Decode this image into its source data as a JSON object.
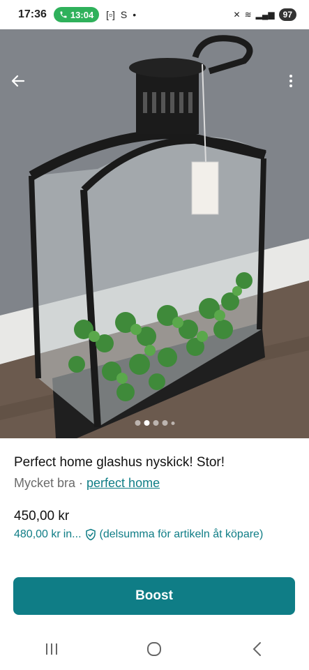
{
  "status_bar": {
    "time": "17:36",
    "call_timer": "13:04",
    "battery": "97",
    "icons": [
      "phone-icon",
      "screen-record-icon",
      "s-icon",
      "dot-icon",
      "mute-icon",
      "wifi-icon",
      "signal-icon",
      "battery-icon"
    ]
  },
  "hero": {
    "image_subject": "glass-lantern-terrarium-photo",
    "dots_total": 5,
    "dots_active": 2
  },
  "listing": {
    "title": "Perfect home glashus nyskick! Stor!",
    "condition": "Mycket bra",
    "separator": " · ",
    "brand": "perfect home",
    "price": "450,00 kr",
    "price_incl": "480,00 kr",
    "price_incl_suffix": "in...",
    "protection_text": "(delsumma för artikeln åt köpare)"
  },
  "actions": {
    "boost_label": "Boost"
  },
  "colors": {
    "accent": "#0f7d86",
    "call_pill": "#2fb15b"
  }
}
